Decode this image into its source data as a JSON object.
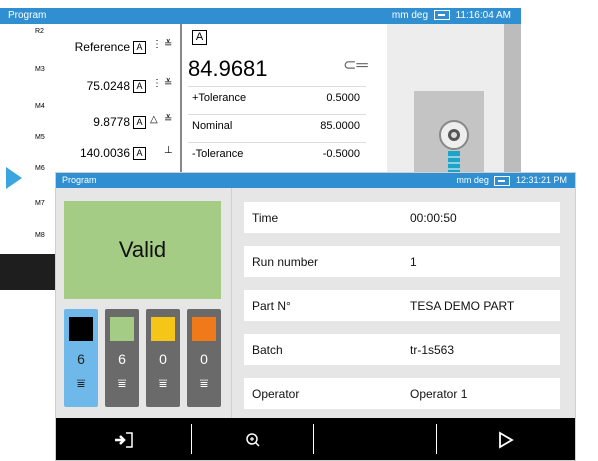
{
  "back_window": {
    "title": "Program",
    "status": {
      "units": "mm deg",
      "time": "11:16:04 AM"
    },
    "rows": [
      {
        "id": "R2",
        "value": "Reference",
        "marker": "A"
      },
      {
        "id": "M3",
        "value": "75.0248",
        "marker": "A"
      },
      {
        "id": "M4",
        "value": "9.8778",
        "marker": "A"
      },
      {
        "id": "M5",
        "value": "140.0036",
        "marker": "A"
      },
      {
        "id": "M6",
        "value": "",
        "marker": ""
      },
      {
        "id": "M7",
        "value": "",
        "marker": ""
      },
      {
        "id": "M8",
        "value": "",
        "marker": ""
      }
    ],
    "result_marker": "A",
    "big_value": "84.9681",
    "tolerances": [
      {
        "label": "+Tolerance",
        "value": "0.5000"
      },
      {
        "label": "Nominal",
        "value": "85.0000"
      },
      {
        "label": "-Tolerance",
        "value": "-0.5000"
      }
    ]
  },
  "front_window": {
    "title": "Program",
    "status": {
      "units": "mm deg",
      "time": "12:31:21 PM"
    },
    "valid_label": "Valid",
    "counters": [
      {
        "value": "6",
        "color": "#000000",
        "selected": true
      },
      {
        "value": "6",
        "color": "#a5cc85",
        "selected": false
      },
      {
        "value": "0",
        "color": "#f5c518",
        "selected": false
      },
      {
        "value": "0",
        "color": "#f07a1a",
        "selected": false
      }
    ],
    "info": [
      {
        "label": "Time",
        "value": "00:00:50"
      },
      {
        "label": "Run number",
        "value": "1"
      },
      {
        "label": "Part N°",
        "value": "TESA DEMO PART"
      },
      {
        "label": "Batch",
        "value": "tr-1s563"
      },
      {
        "label": "Operator",
        "value": "Operator 1"
      }
    ],
    "toolbar": [
      "exit-icon",
      "zoom-icon",
      "blank",
      "play-icon"
    ]
  },
  "colors": {
    "accent": "#2f8fd0",
    "valid": "#a5cc85",
    "selected": "#6fb9ea"
  }
}
